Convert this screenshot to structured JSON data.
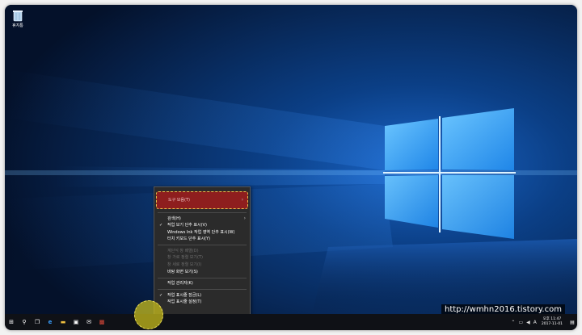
{
  "desktop": {
    "recycle_bin_label": "휴지통"
  },
  "context_menu": {
    "items": [
      {
        "label": "도구 모음(T)",
        "has_submenu": true,
        "highlighted": true
      },
      {
        "label": "검색(H)",
        "has_submenu": true
      },
      {
        "label": "작업 보기 단추 표시(V)",
        "checked": true
      },
      {
        "label": "Windows Ink 작업 영역 단추 표시(W)"
      },
      {
        "label": "터치 키보드 단추 표시(Y)"
      },
      {
        "label": "계단식 창 배열(D)",
        "disabled": true
      },
      {
        "label": "창 가로 정렬 보기(T)",
        "disabled": true
      },
      {
        "label": "창 세로 정렬 보기(I)",
        "disabled": true
      },
      {
        "label": "바탕 화면 보기(S)"
      },
      {
        "label": "작업 관리자(K)"
      },
      {
        "label": "작업 표시줄 잠금(L)",
        "checked": true
      },
      {
        "label": "작업 표시줄 설정(T)"
      }
    ],
    "check_glyph": "✓",
    "arrow_glyph": "›"
  },
  "taskbar": {
    "buttons": [
      {
        "name": "start-button",
        "icon": "windows-logo-icon",
        "glyph": "⊞"
      },
      {
        "name": "search-button",
        "icon": "search-icon",
        "glyph": "⚲"
      },
      {
        "name": "task-view-button",
        "icon": "task-view-icon",
        "glyph": "❐"
      },
      {
        "name": "edge-button",
        "icon": "edge-icon",
        "glyph": "e"
      },
      {
        "name": "explorer-button",
        "icon": "folder-icon",
        "glyph": "▬"
      },
      {
        "name": "store-button",
        "icon": "store-icon",
        "glyph": "▣"
      },
      {
        "name": "mail-button",
        "icon": "mail-icon",
        "glyph": "✉"
      },
      {
        "name": "app-button",
        "icon": "app-icon",
        "glyph": "▩"
      }
    ],
    "tray": {
      "ime_label": "A",
      "clock_time": "오후 11:47",
      "clock_date": "2017-11-01"
    }
  },
  "watermark": {
    "text": "http://wmhn2016.tistory.com"
  },
  "colors": {
    "menu_highlight": "#8e1e1e",
    "callout_yellow": "#cdc21c",
    "taskbar": "#0f1116"
  }
}
